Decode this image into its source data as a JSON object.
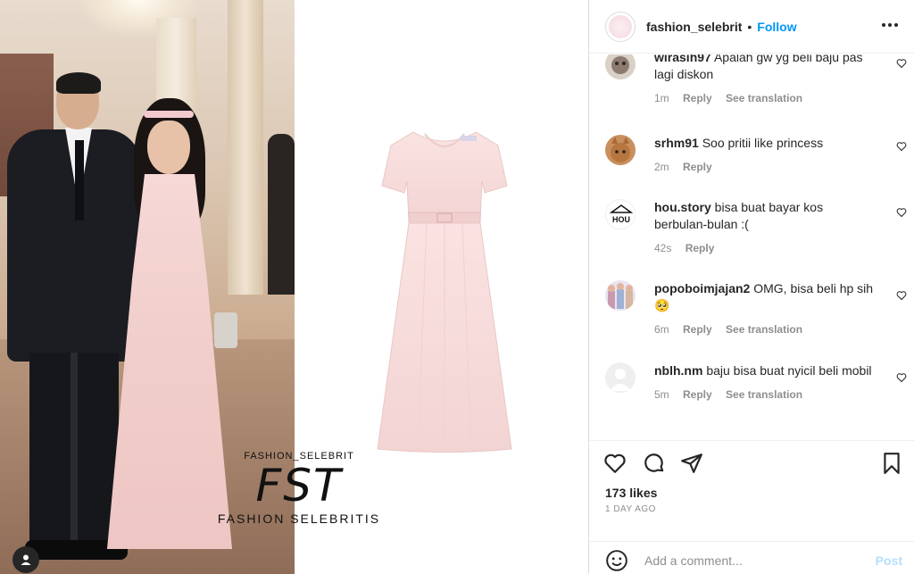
{
  "post": {
    "watermark_top": "FASHION_SELEBRIT",
    "watermark_logo": "FST",
    "watermark_bottom": "FASHION SELEBRITIS"
  },
  "header": {
    "username": "fashion_selebrit",
    "separator": "•",
    "follow_label": "Follow",
    "more_icon": "more-horizontal-icon"
  },
  "comments": [
    {
      "user": "wirasih97",
      "text": "Apalah gw yg beli baju pas lagi diskon",
      "time": "1m",
      "reply": "Reply",
      "translate": "See translation"
    },
    {
      "user": "srhm91",
      "text": "Soo pritii like princess",
      "time": "2m",
      "reply": "Reply",
      "translate": ""
    },
    {
      "user": "hou.story",
      "text": "bisa buat bayar kos berbulan-bulan :(",
      "time": "42s",
      "reply": "Reply",
      "translate": ""
    },
    {
      "user": "popoboimjajan2",
      "text": "OMG, bisa beli hp sih 🥺",
      "time": "6m",
      "reply": "Reply",
      "translate": "See translation"
    },
    {
      "user": "nblh.nm",
      "text": "baju bisa buat nyicil beli mobil",
      "time": "5m",
      "reply": "Reply",
      "translate": "See translation"
    }
  ],
  "avatar_text": {
    "hou": "HOU"
  },
  "actions": {
    "likes": "173 likes",
    "time_ago": "1 DAY AGO"
  },
  "add_comment": {
    "placeholder": "Add a comment...",
    "post_label": "Post"
  },
  "colors": {
    "accent": "#0095f6",
    "post_disabled": "#b2dffc",
    "text_primary": "#262626",
    "text_secondary": "#8e8e8e"
  }
}
